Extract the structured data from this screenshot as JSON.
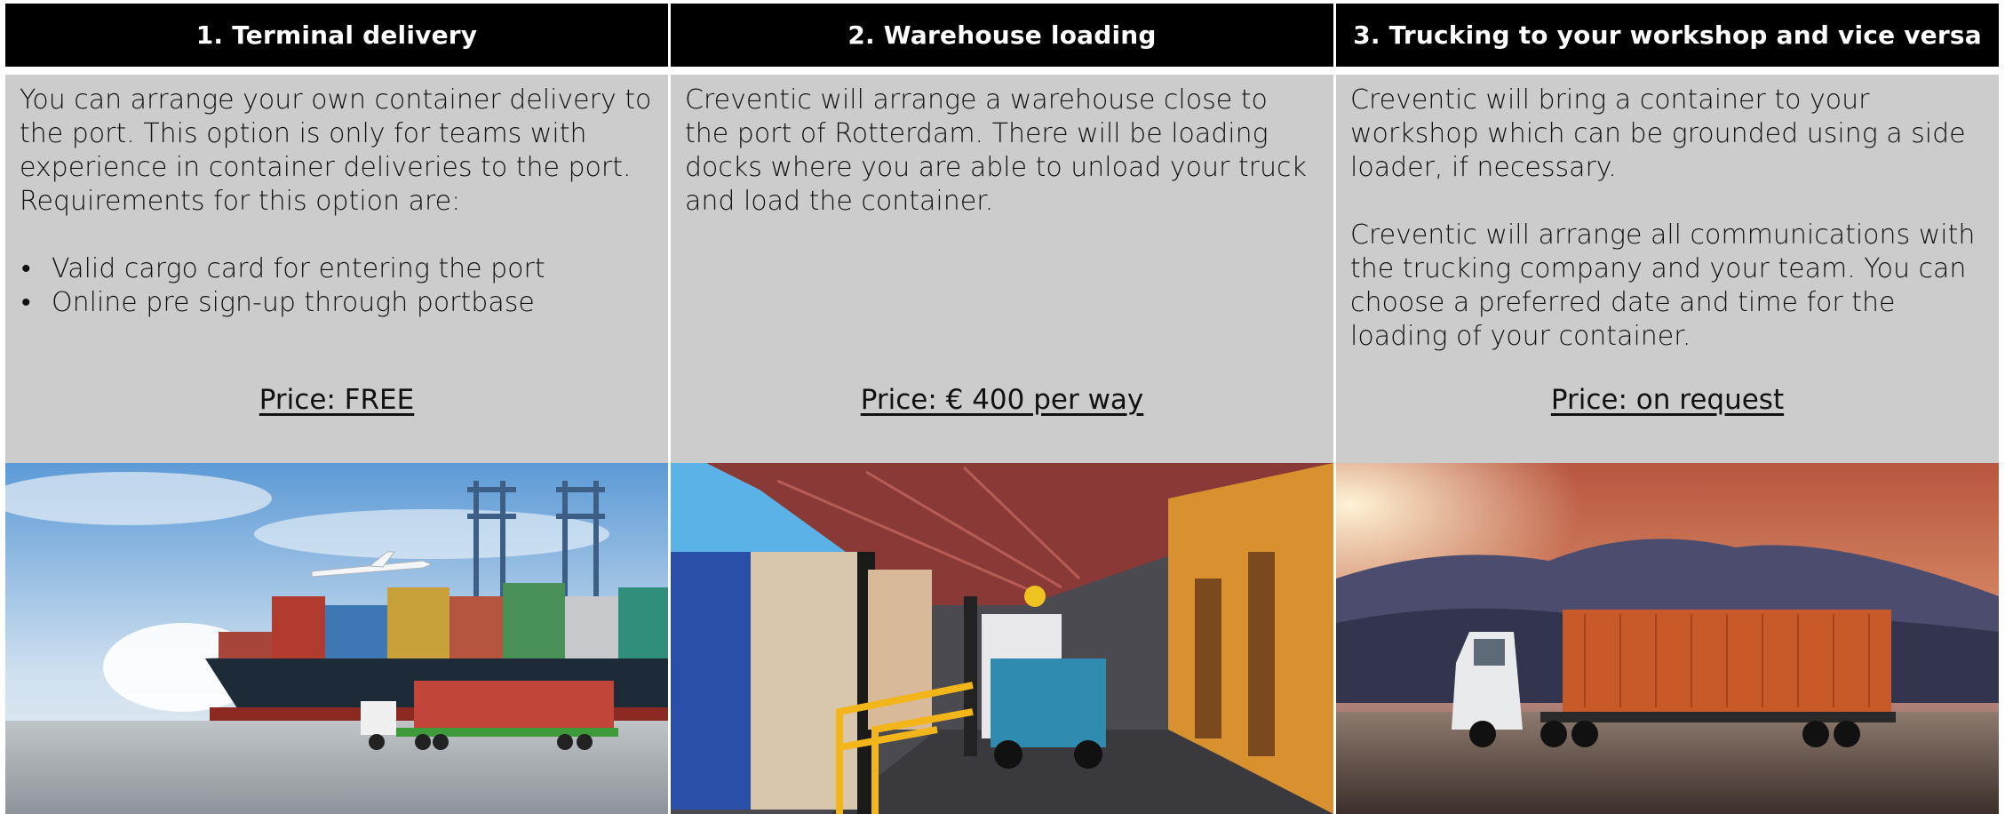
{
  "columns": [
    {
      "title": "1. Terminal delivery",
      "paragraphs": [
        "You can arrange your own container delivery to the port. This option is only for teams with experience in container deliveries to the port. Requirements for this option are:"
      ],
      "bullets": [
        "Valid cargo card for entering the port",
        "Online pre sign-up through portbase"
      ],
      "price": "Price: FREE",
      "image": "port-cranes-cargo-ship-truck-photo"
    },
    {
      "title": "2. Warehouse loading",
      "paragraphs": [
        "Creventic will arrange a warehouse close to the port of Rotterdam. There will be loading docks where you are able to unload your truck and load the container."
      ],
      "bullets": [],
      "price": "Price: € 400 per way",
      "image": "warehouse-forklift-loading-dock-photo"
    },
    {
      "title": "3. Trucking to your workshop and vice versa",
      "paragraphs": [
        "Creventic will bring a container to your workshop which can be grounded using a side loader, if necessary.",
        "Creventic will arrange all communications with the trucking company and your team. You can choose a preferred date and time for the loading of your container."
      ],
      "bullets": [],
      "price": "Price: on request",
      "image": "container-truck-sunset-photo"
    }
  ],
  "colors": {
    "header_bg": "#000000",
    "header_text": "#ffffff",
    "body_bg": "#cccccc",
    "text": "#111111"
  }
}
